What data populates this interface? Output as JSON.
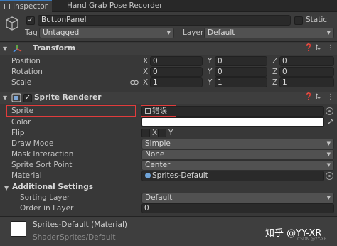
{
  "tabs": [
    {
      "label": "Inspector"
    },
    {
      "label": "Hand Grab Pose Recorder"
    }
  ],
  "header": {
    "object_name": "ButtonPanel",
    "static_label": "Static",
    "tag_label": "Tag",
    "tag_value": "Untagged",
    "layer_label": "Layer",
    "layer_value": "Default"
  },
  "transform": {
    "title": "Transform",
    "rows": [
      {
        "label": "Position",
        "x": "0",
        "y": "0",
        "z": "0"
      },
      {
        "label": "Rotation",
        "x": "0",
        "y": "0",
        "z": "0"
      },
      {
        "label": "Scale",
        "x": "1",
        "y": "1",
        "z": "1"
      }
    ],
    "axis": {
      "x": "X",
      "y": "Y",
      "z": "Z"
    }
  },
  "sprite_renderer": {
    "title": "Sprite Renderer",
    "sprite_label": "Sprite",
    "sprite_value": "错误",
    "color_label": "Color",
    "flip_label": "Flip",
    "flip_x": "X",
    "flip_y": "Y",
    "draw_mode_label": "Draw Mode",
    "draw_mode_value": "Simple",
    "mask_label": "Mask Interaction",
    "mask_value": "None",
    "sort_point_label": "Sprite Sort Point",
    "sort_point_value": "Center",
    "material_label": "Material",
    "material_value": "Sprites-Default",
    "additional_title": "Additional Settings",
    "sorting_layer_label": "Sorting Layer",
    "sorting_layer_value": "Default",
    "order_label": "Order in Layer",
    "order_value": "0"
  },
  "material": {
    "name": "Sprites-Default (Material)",
    "shader_label": "Shader",
    "shader_value": "Sprites/Default"
  },
  "watermark": {
    "text": "知乎 @YY-XR",
    "sub": "CSDN @YY-XR"
  },
  "colors": {
    "accent": "#3a79bb",
    "highlight": "#e13c3c",
    "color_field": "#ffffff"
  }
}
